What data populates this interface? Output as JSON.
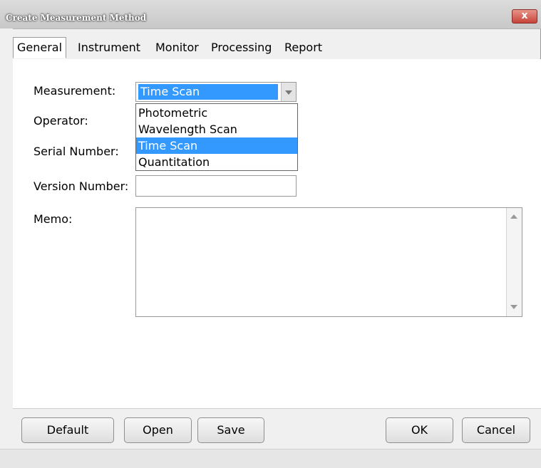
{
  "window": {
    "title": "Create Measurement Method",
    "close_label": "x"
  },
  "tabs": [
    {
      "label": "General",
      "active": true
    },
    {
      "label": "Instrument",
      "active": false
    },
    {
      "label": "Monitor",
      "active": false
    },
    {
      "label": "Processing",
      "active": false
    },
    {
      "label": "Report",
      "active": false
    }
  ],
  "form": {
    "measurement_label": "Measurement:",
    "measurement_value": "Time Scan",
    "operator_label": "Operator:",
    "operator_value": "",
    "serial_label": "Serial Number:",
    "serial_value": "",
    "version_label": "Version Number:",
    "version_value": "",
    "memo_label": "Memo:",
    "memo_value": ""
  },
  "dropdown": {
    "options": [
      "Photometric",
      "Wavelength Scan",
      "Time Scan",
      "Quantitation"
    ],
    "selected": "Time Scan"
  },
  "buttons": {
    "default": "Default",
    "open": "Open",
    "save": "Save",
    "ok": "OK",
    "cancel": "Cancel"
  },
  "colors": {
    "selection": "#3399ff",
    "close_button": "#c6433a"
  }
}
